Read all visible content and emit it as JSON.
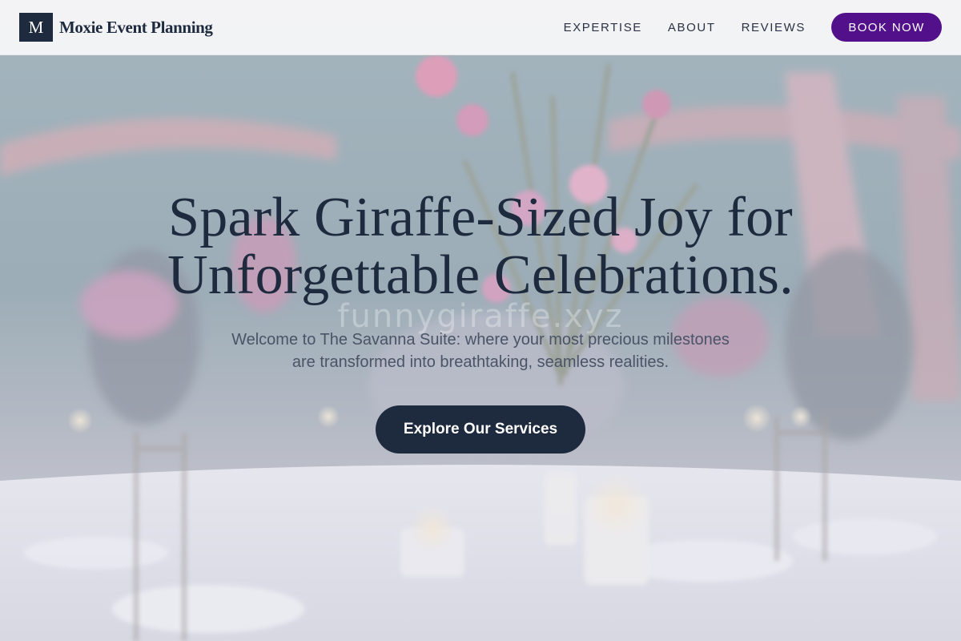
{
  "brand": {
    "mark": "M",
    "name": "Moxie Event Planning"
  },
  "nav": {
    "links": [
      "EXPERTISE",
      "ABOUT",
      "REVIEWS"
    ],
    "book_label": "BOOK NOW"
  },
  "hero": {
    "title_line1": "Spark Giraffe-Sized Joy for",
    "title_line2": "Unforgettable Celebrations.",
    "subtitle_line1": "Welcome to The Savanna Suite: where your most precious milestones",
    "subtitle_line2": "are transformed into breathtaking, seamless realities.",
    "cta_label": "Explore Our Services",
    "watermark": "funnygiraffe.xyz",
    "background_image": "wedding reception banquet table with floral centerpiece and candles"
  },
  "colors": {
    "brand_navy": "#1e2a3e",
    "book_purple": "#52108a",
    "subtitle_gray": "#4a5466"
  }
}
